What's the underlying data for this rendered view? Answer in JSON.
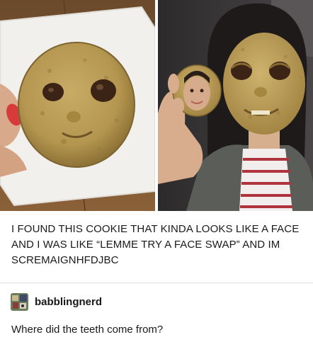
{
  "post": {
    "caption": "I FOUND THIS COOKIE THAT KINDA LOOKS LIKE A FACE AND I WAS LIKE “LEMME TRY A FACE SWAP” AND IM SCREMAIGNHFDJBC"
  },
  "reply": {
    "username": "babblingnerd",
    "text": "Where did the teeth come from?"
  },
  "colors": {
    "text": "#1a1a1a",
    "divider": "#dcdcdc",
    "cookie": "#b89a55"
  }
}
